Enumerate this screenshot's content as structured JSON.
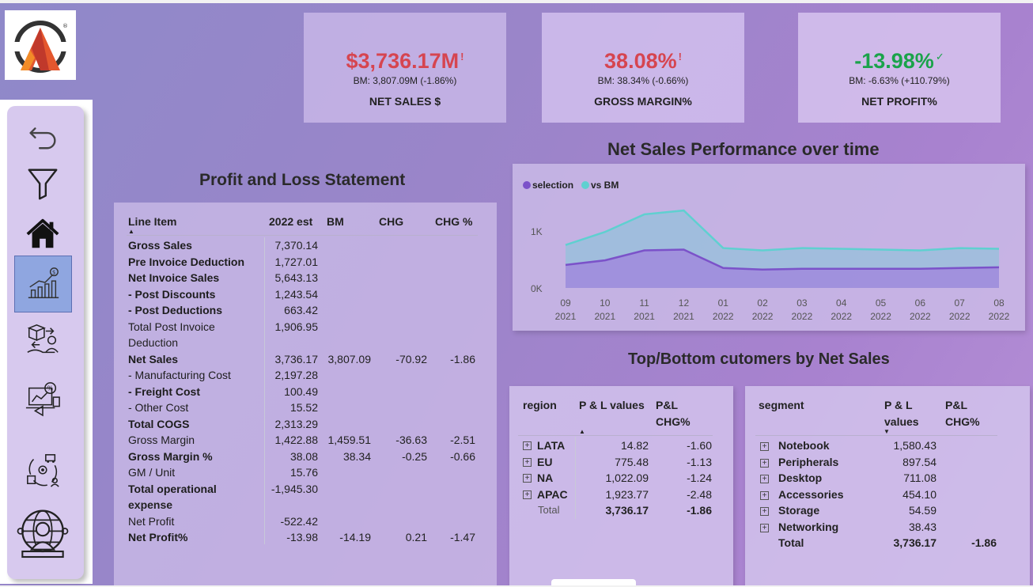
{
  "kpis": [
    {
      "value": "$3,736.17M",
      "mark": "!",
      "bm": "BM: 3,807.09M (-1.86%)",
      "label": "NET SALES $",
      "status": "red"
    },
    {
      "value": "38.08%",
      "mark": "!",
      "bm": "BM: 38.34% (-0.66%)",
      "label": "GROSS MARGIN%",
      "status": "red"
    },
    {
      "value": "-13.98%",
      "mark": "✓",
      "bm": "BM: -6.63% (+110.79%)",
      "label": "NET PROFIT%",
      "status": "green"
    }
  ],
  "titles": {
    "pl": "Profit and Loss Statement",
    "chart": "Net Sales Performance over time",
    "customers": "Top/Bottom cutomers by Net Sales"
  },
  "pl": {
    "headers": [
      "Line Item",
      "2022 est",
      "BM",
      "CHG",
      "CHG %"
    ],
    "rows": [
      {
        "item": "Gross Sales",
        "est": "7,370.14",
        "bm": "",
        "chg": "",
        "pct": "",
        "bold": true
      },
      {
        "item": "Pre Invoice Deduction",
        "est": "1,727.01",
        "bm": "",
        "chg": "",
        "pct": "",
        "bold": true
      },
      {
        "item": "Net Invoice Sales",
        "est": "5,643.13",
        "bm": "",
        "chg": "",
        "pct": "",
        "bold": true
      },
      {
        "item": "- Post Discounts",
        "est": "1,243.54",
        "bm": "",
        "chg": "",
        "pct": "",
        "bold": true
      },
      {
        "item": "- Post Deductions",
        "est": "663.42",
        "bm": "",
        "chg": "",
        "pct": "",
        "bold": true
      },
      {
        "item": "Total Post Invoice",
        "item2": "Deduction",
        "est": "1,906.95",
        "bm": "",
        "chg": "",
        "pct": "",
        "bold": false
      },
      {
        "item": "Net Sales",
        "est": "3,736.17",
        "bm": "3,807.09",
        "chg": "-70.92",
        "pct": "-1.86",
        "bold": true
      },
      {
        "item": "- Manufacturing Cost",
        "est": "2,197.28",
        "bm": "",
        "chg": "",
        "pct": "",
        "bold": false
      },
      {
        "item": "- Freight Cost",
        "est": "100.49",
        "bm": "",
        "chg": "",
        "pct": "",
        "bold": true
      },
      {
        "item": "- Other Cost",
        "est": "15.52",
        "bm": "",
        "chg": "",
        "pct": "",
        "bold": false
      },
      {
        "item": "Total COGS",
        "est": "2,313.29",
        "bm": "",
        "chg": "",
        "pct": "",
        "bold": true
      },
      {
        "item": "Gross Margin",
        "est": "1,422.88",
        "bm": "1,459.51",
        "chg": "-36.63",
        "pct": "-2.51",
        "bold": false
      },
      {
        "item": "Gross Margin %",
        "est": "38.08",
        "bm": "38.34",
        "chg": "-0.25",
        "pct": "-0.66",
        "bold": true
      },
      {
        "item": "GM / Unit",
        "est": "15.76",
        "bm": "",
        "chg": "",
        "pct": "",
        "bold": false
      },
      {
        "item": "Total operational",
        "item2": "expense",
        "est": "-1,945.30",
        "bm": "",
        "chg": "",
        "pct": "",
        "bold": true
      },
      {
        "item": "Net Profit",
        "est": "-522.42",
        "bm": "",
        "chg": "",
        "pct": "",
        "bold": false
      },
      {
        "item": "Net Profit%",
        "est": "-13.98",
        "bm": "-14.19",
        "chg": "0.21",
        "pct": "-1.47",
        "bold": true
      }
    ]
  },
  "chart_data": {
    "type": "area",
    "legend": [
      "selection",
      "vs BM"
    ],
    "legend_position": "top-left",
    "x": [
      "09 2021",
      "10 2021",
      "11 2021",
      "12 2021",
      "01 2022",
      "02 2022",
      "03 2022",
      "04 2022",
      "05 2022",
      "06 2022",
      "07 2022",
      "08 2022"
    ],
    "x_top": [
      "09",
      "10",
      "11",
      "12",
      "01",
      "02",
      "03",
      "04",
      "05",
      "06",
      "07",
      "08"
    ],
    "x_bottom": [
      "2021",
      "2021",
      "2021",
      "2021",
      "2022",
      "2022",
      "2022",
      "2022",
      "2022",
      "2022",
      "2022",
      "2022"
    ],
    "yticks": [
      "1K",
      "0K"
    ],
    "ylim": [
      0,
      1300
    ],
    "series": [
      {
        "name": "selection",
        "color": "#7b52c9",
        "values": [
          300,
          360,
          490,
          500,
          260,
          240,
          250,
          250,
          250,
          250,
          260,
          270
        ]
      },
      {
        "name": "vs BM",
        "color": "#5fd0d0",
        "values": [
          560,
          730,
          960,
          1010,
          520,
          490,
          520,
          510,
          500,
          490,
          520,
          510
        ]
      }
    ]
  },
  "region": {
    "headers": [
      "region",
      "P & L values",
      "P&L",
      "CHG%"
    ],
    "rows": [
      {
        "name": "LATA",
        "value": "14.82",
        "chg": "-1.60"
      },
      {
        "name": "EU",
        "value": "775.48",
        "chg": "-1.13"
      },
      {
        "name": "NA",
        "value": "1,022.09",
        "chg": "-1.24"
      },
      {
        "name": "APAC",
        "value": "1,923.77",
        "chg": "-2.48"
      }
    ],
    "total": {
      "label": "Total",
      "value": "3,736.17",
      "chg": "-1.86"
    }
  },
  "segment": {
    "headers": [
      "segment",
      "P & L",
      "values",
      "P&L",
      "CHG%"
    ],
    "rows": [
      {
        "name": "Notebook",
        "value": "1,580.43"
      },
      {
        "name": "Peripherals",
        "value": "897.54"
      },
      {
        "name": "Desktop",
        "value": "711.08"
      },
      {
        "name": "Accessories",
        "value": "454.10"
      },
      {
        "name": "Storage",
        "value": "54.59"
      },
      {
        "name": "Networking",
        "value": "38.43"
      }
    ],
    "total": {
      "label": "Total",
      "value": "3,736.17",
      "chg": "-1.86"
    }
  },
  "colors": {
    "negative": "#d64550",
    "positive": "#1aa34a",
    "active_nav": "#8fa6e0"
  },
  "nav_icons": [
    "back-arrow-icon",
    "filter-icon",
    "home-icon",
    "finance-chart-icon",
    "supply-exchange-icon",
    "marketing-icon",
    "supply-chain-icon",
    "executive-globe-icon"
  ]
}
